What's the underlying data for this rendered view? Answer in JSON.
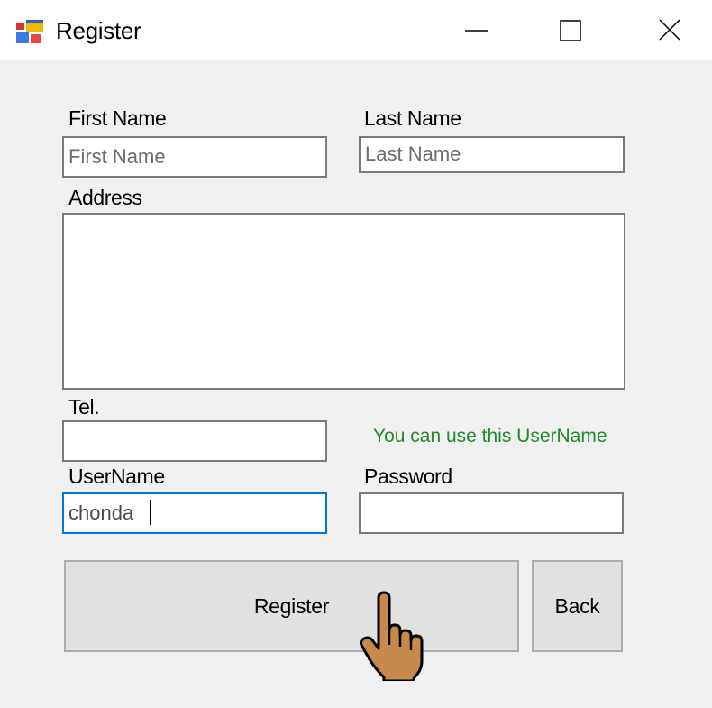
{
  "window": {
    "title": "Register",
    "icon": "winforms-app-icon",
    "controls": [
      "minimize-icon",
      "maximize-icon",
      "close-icon"
    ]
  },
  "form": {
    "first_name": {
      "label": "First Name",
      "placeholder": "First Name",
      "value": ""
    },
    "last_name": {
      "label": "Last Name",
      "placeholder": "Last Name",
      "value": ""
    },
    "address": {
      "label": "Address",
      "value": ""
    },
    "tel": {
      "label": "Tel.",
      "value": ""
    },
    "username": {
      "label": "UserName",
      "value": "chonda"
    },
    "password": {
      "label": "Password",
      "value": ""
    },
    "username_status": "You can use this UserName"
  },
  "buttons": {
    "register": "Register",
    "back": "Back"
  },
  "cursor": "hand-pointer-icon",
  "colors": {
    "client_bg": "#f0f0f0",
    "focus_border": "#0078d7",
    "status_text": "#1f8a2c",
    "button_bg": "#e1e1e1"
  }
}
